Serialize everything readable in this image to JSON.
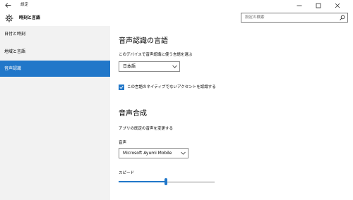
{
  "window": {
    "app_title": "設定",
    "controls": {
      "minimize": "minimize-icon",
      "maximize": "maximize-icon",
      "close": "close-icon"
    }
  },
  "header": {
    "title": "時刻と言語",
    "search_placeholder": "設定の検索"
  },
  "sidebar": {
    "items": [
      {
        "label": "日付と時刻"
      },
      {
        "label": "地域と言語"
      },
      {
        "label": "音声認識"
      }
    ],
    "selected_index": 2
  },
  "main": {
    "speech_recognition": {
      "heading": "音声認識の言語",
      "language_label": "このデバイスで音声認識に使う言語を選ぶ",
      "language_value": "日本語",
      "non_native_checkbox_label": "この言語のネイティブでないアクセントを認識する",
      "non_native_checked": true
    },
    "speech_synthesis": {
      "heading": "音声合成",
      "description": "アプリの既定の音声を変更する",
      "voice_label": "音声",
      "voice_value": "Microsoft Ayumi Mobile",
      "speed_label": "スピード",
      "speed_value_fraction": 0.5
    }
  },
  "colors": {
    "accent": "#2177c9",
    "sidebar_bg": "#f2f2f2",
    "content_bg": "#ffffff"
  }
}
